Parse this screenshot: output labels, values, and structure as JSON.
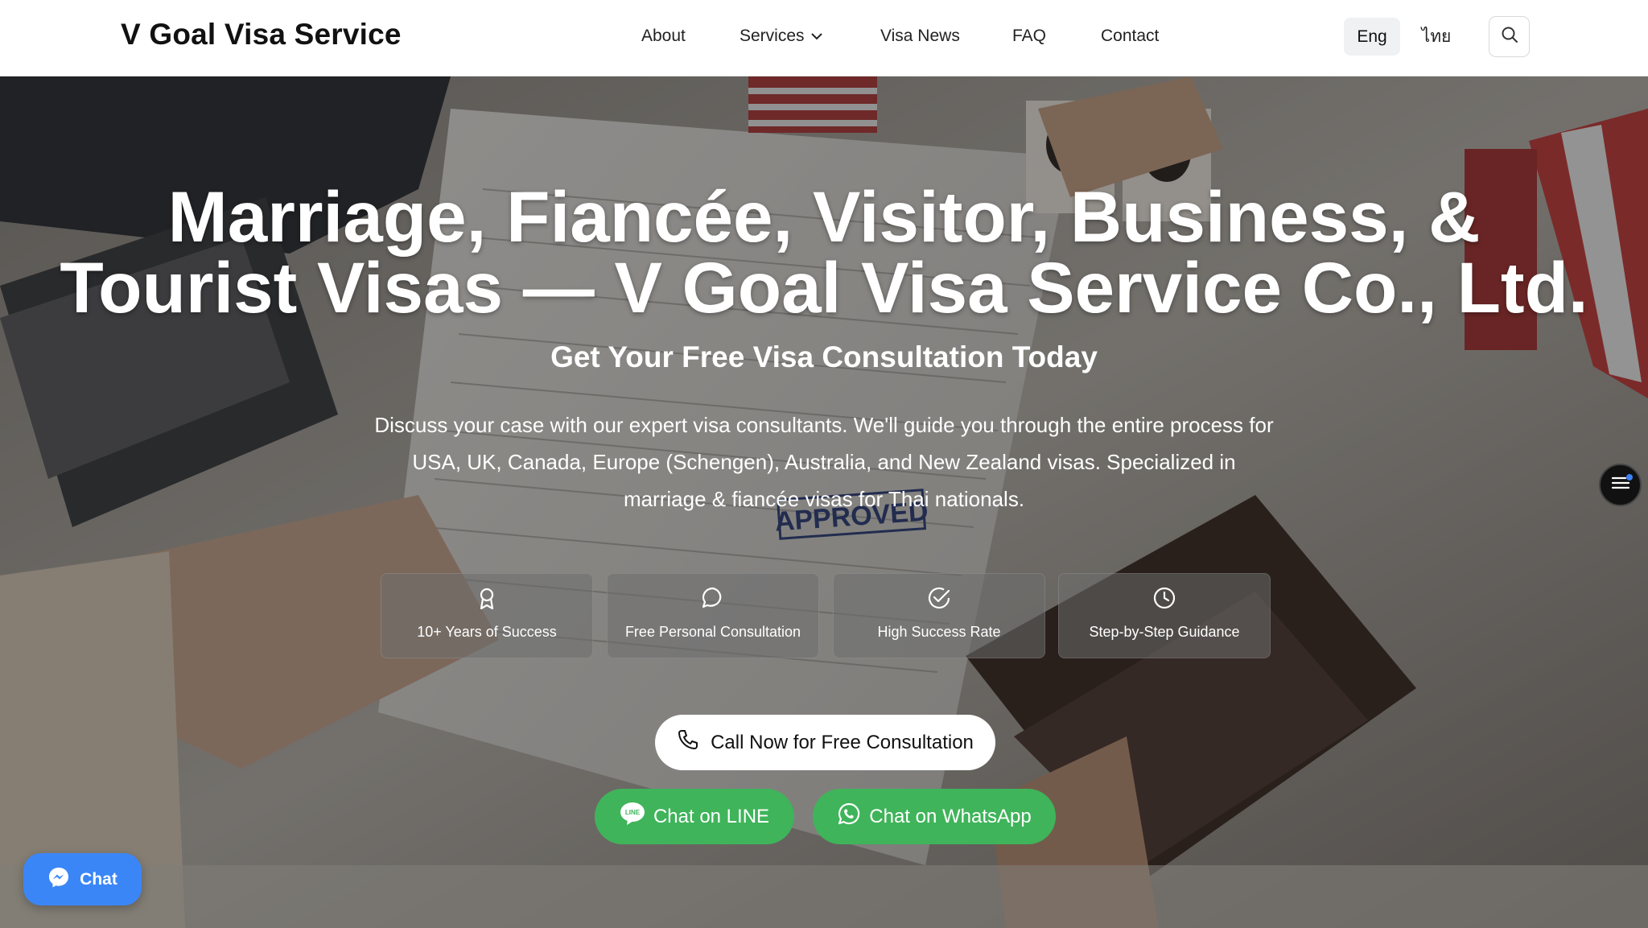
{
  "header": {
    "brand": "V Goal Visa Service",
    "nav": [
      {
        "label": "About"
      },
      {
        "label": "Services"
      },
      {
        "label": "Visa News"
      },
      {
        "label": "FAQ"
      },
      {
        "label": "Contact"
      }
    ],
    "lang_active": "Eng",
    "lang_other": "ไทย",
    "search_icon": "search-icon"
  },
  "hero": {
    "title_line1": "Marriage, Fiancée, Visitor, Business, &",
    "title_line2": "Tourist Visas — V Goal Visa Service Co., Ltd.",
    "subtitle": "Get Your Free Visa Consultation Today",
    "description": "Discuss your case with our expert visa consultants. We'll guide you through the entire process for USA, UK, Canada, Europe (Schengen), Australia, and New Zealand visas. Specialized in marriage & fiancée visas for Thai nationals.",
    "features": [
      {
        "label": "10+ Years of Success",
        "icon": "award-icon"
      },
      {
        "label": "Free Personal Consultation",
        "icon": "message-circle-icon"
      },
      {
        "label": "High Success Rate",
        "icon": "check-circle-icon"
      },
      {
        "label": "Step-by-Step Guidance",
        "icon": "clock-icon"
      }
    ],
    "cta_call": "Call Now for Free Consultation",
    "cta_line": "Chat on LINE",
    "cta_whatsapp": "Chat on WhatsApp",
    "background_stamp_text": "APPROVED"
  },
  "floating": {
    "chat_label": "Chat",
    "toc_icon": "list-menu-icon"
  },
  "colors": {
    "green": "#3fb45a",
    "messenger_blue": "#3b86f7"
  }
}
